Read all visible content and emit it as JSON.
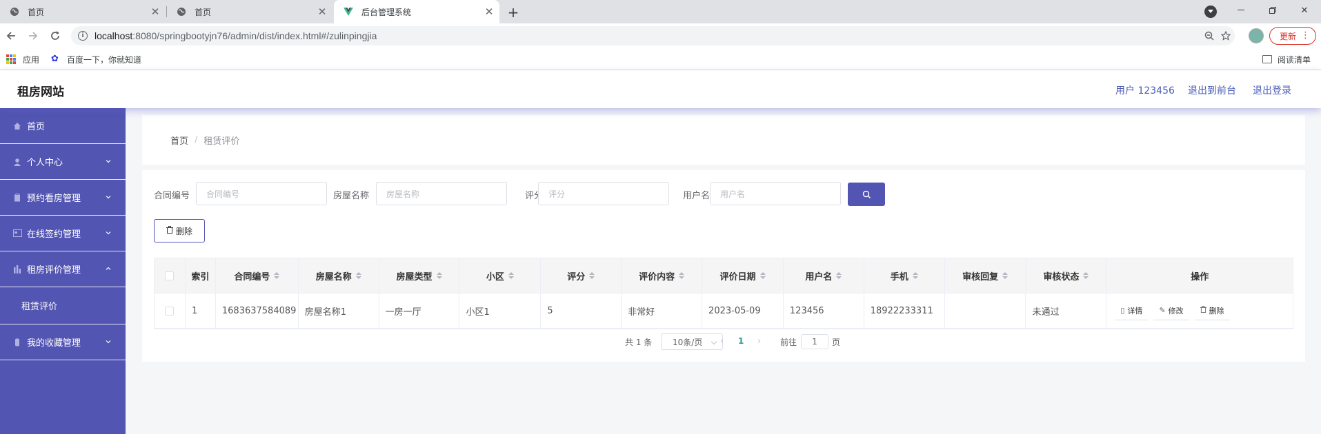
{
  "browser": {
    "tabs": [
      {
        "title": "首页",
        "active": false
      },
      {
        "title": "首页",
        "active": false
      },
      {
        "title": "后台管理系统",
        "active": true
      }
    ],
    "url_host": "localhost",
    "url_path": ":8080/springbootyjn76/admin/dist/index.html#/zulinpingjia",
    "update_label": "更新",
    "bookmarks": {
      "apps": "应用",
      "baidu": "百度一下，你就知道",
      "reading_list": "阅读清单"
    }
  },
  "header": {
    "title": "租房网站",
    "user": "用户 123456",
    "back_to_front": "退出到前台",
    "logout": "退出登录"
  },
  "sidebar": {
    "items": [
      {
        "label": "首页",
        "icon": "home-icon",
        "expandable": false
      },
      {
        "label": "个人中心",
        "icon": "user-icon",
        "expandable": true
      },
      {
        "label": "预约看房管理",
        "icon": "clipboard-icon",
        "expandable": true
      },
      {
        "label": "在线签约管理",
        "icon": "card-icon",
        "expandable": true
      },
      {
        "label": "租房评价管理",
        "icon": "chart-icon",
        "expandable": true,
        "expanded": true
      },
      {
        "label": "我的收藏管理",
        "icon": "bookmark-icon",
        "expandable": true
      }
    ],
    "sub_item": "租赁评价"
  },
  "breadcrumb": {
    "home": "首页",
    "separator": "/",
    "current": "租赁评价"
  },
  "search": {
    "contract_label": "合同编号",
    "contract_placeholder": "合同编号",
    "house_label": "房屋名称",
    "house_placeholder": "房屋名称",
    "rating_label": "评分",
    "rating_placeholder": "评分",
    "user_label": "用户名",
    "user_placeholder": "用户名"
  },
  "actions": {
    "delete": "删除"
  },
  "table": {
    "columns": [
      {
        "label": "",
        "sortable": false
      },
      {
        "label": "索引",
        "sortable": false
      },
      {
        "label": "合同编号",
        "sortable": true
      },
      {
        "label": "房屋名称",
        "sortable": true
      },
      {
        "label": "房屋类型",
        "sortable": true
      },
      {
        "label": "小区",
        "sortable": true
      },
      {
        "label": "评分",
        "sortable": true
      },
      {
        "label": "评价内容",
        "sortable": true
      },
      {
        "label": "评价日期",
        "sortable": true
      },
      {
        "label": "用户名",
        "sortable": true
      },
      {
        "label": "手机",
        "sortable": true
      },
      {
        "label": "审核回复",
        "sortable": true
      },
      {
        "label": "审核状态",
        "sortable": true
      },
      {
        "label": "操作",
        "sortable": false
      }
    ],
    "rows": [
      {
        "index": "1",
        "contract_no": "1683637584089",
        "house_name": "房屋名称1",
        "house_type": "一房一厅",
        "community": "小区1",
        "rating": "5",
        "content": "非常好",
        "date": "2023-05-09",
        "username": "123456",
        "phone": "18922233311",
        "reply": "",
        "status": "未通过"
      }
    ],
    "row_actions": {
      "detail": "详情",
      "edit": "修改",
      "delete": "删除"
    }
  },
  "pagination": {
    "total": "共 1 条",
    "page_size": "10条/页",
    "current_page": "1",
    "goto_label": "前往",
    "goto_value": "1",
    "page_suffix": "页"
  },
  "colors": {
    "primary": "#5355b2",
    "link": "#4a5bb5",
    "active_page": "#2f9e9a"
  }
}
